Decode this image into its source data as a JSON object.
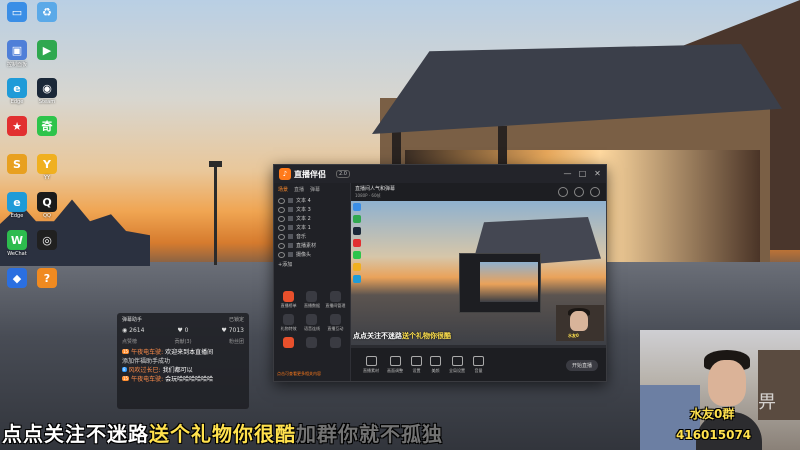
{
  "desktop": {
    "icons": [
      {
        "label": "",
        "icon": "computer-icon",
        "color": "#3a8ee6",
        "glyph": "▭"
      },
      {
        "label": "",
        "icon": "recycle-bin-icon",
        "color": "#5aa9e8",
        "glyph": "♻"
      },
      {
        "label": "控制面板",
        "icon": "control-panel-icon",
        "color": "#4f7fd8",
        "glyph": "▣"
      },
      {
        "label": "",
        "icon": "player-icon",
        "color": "#2fa84f",
        "glyph": "▶"
      },
      {
        "label": "Edge",
        "icon": "edge-icon",
        "color": "#1f9bd8",
        "glyph": "e"
      },
      {
        "label": "Steam",
        "icon": "steam-icon",
        "color": "#1b2838",
        "glyph": "◉"
      },
      {
        "label": "",
        "icon": "game-platform-icon",
        "color": "#e23030",
        "glyph": "★"
      },
      {
        "label": "",
        "icon": "iqiyi-icon",
        "color": "#2ec44b",
        "glyph": "奇"
      },
      {
        "label": "",
        "icon": "pinyin-icon",
        "color": "#e8a020",
        "glyph": "S"
      },
      {
        "label": "YY",
        "icon": "yy-icon",
        "color": "#f0b020",
        "glyph": "Y"
      },
      {
        "label": "Edge",
        "icon": "edge-icon-2",
        "color": "#1f9bd8",
        "glyph": "e"
      },
      {
        "label": "QQ",
        "icon": "qq-icon",
        "color": "#1b1b1b",
        "glyph": "Q"
      },
      {
        "label": "WeChat",
        "icon": "wechat-icon",
        "color": "#2dbb4e",
        "glyph": "W"
      },
      {
        "label": "",
        "icon": "obs-icon",
        "color": "#202020",
        "glyph": "◎"
      },
      {
        "label": "",
        "icon": "app-blue-icon",
        "color": "#2b6fe0",
        "glyph": "◆"
      },
      {
        "label": "",
        "icon": "app-orange-icon",
        "color": "#f08a20",
        "glyph": "?"
      }
    ]
  },
  "app": {
    "name": "直播伴侣",
    "badge": "2.0",
    "window_buttons": [
      "—",
      "□",
      "✕"
    ],
    "side_tabs": [
      "场景",
      "直播",
      "弹幕"
    ],
    "scenes": [
      "文本 4",
      "文本 3",
      "文本 2",
      "文本 1",
      "音乐",
      "直播素材",
      "摄像头"
    ],
    "add_scene": "+添加",
    "side_grid": [
      "直播榜单",
      "直播数据",
      "直播间管理",
      "礼物特效",
      "语音连线",
      "直播互动",
      "",
      "",
      ""
    ],
    "side_footer": "点击可查看更多相关内容",
    "room_title": "直播间人气和弹幕",
    "room_sub": "1080P · 60帧",
    "preview_ticker_white": "点点关注不迷路",
    "preview_ticker_yellow": "送个礼物你很酷",
    "preview_cam_name": "水友0",
    "toolbar": [
      "直播素材",
      "画面调整",
      "设置",
      "美颜",
      "全局设置",
      "音量"
    ],
    "live_button": "开始直播"
  },
  "chat": {
    "header": "弹幕助手",
    "pin": "已锁定",
    "stats": [
      "2614",
      "0",
      "7013"
    ],
    "tabs": [
      "点赞榜",
      "贡献(3)",
      "粉丝团"
    ],
    "messages": [
      {
        "level": "15",
        "user": "午夜电车驶:",
        "text": "欢迎来到本直播间",
        "level_color": "o"
      },
      {
        "level": "",
        "user": "",
        "text": "添加伴福助手成功",
        "level_color": ""
      },
      {
        "level": "8",
        "user": "风吹过长巳:",
        "text": "我们都可以",
        "level_color": "b"
      },
      {
        "level": "15",
        "user": "午夜电车驶:",
        "text": "会玩哈哈哈哈哈哈",
        "level_color": "o"
      }
    ]
  },
  "webcam": {
    "overlay_name": "水友0群",
    "overlay_number": "416015074"
  },
  "ticker": {
    "white": "点点关注不迷路",
    "yellow": "送个礼物你很酷",
    "faded": "加群你就不孤独"
  }
}
